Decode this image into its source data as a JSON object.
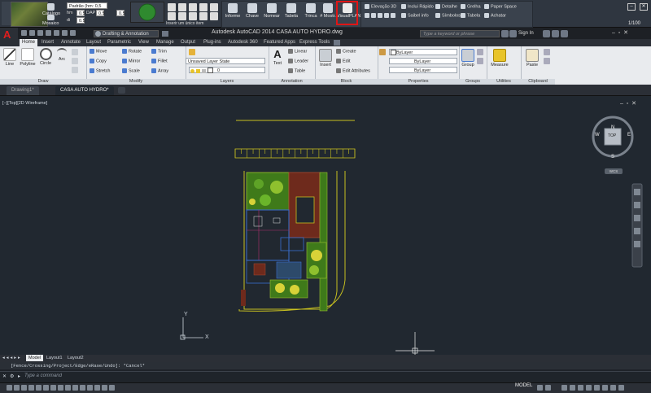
{
  "plugin_toolbar": {
    "left_buttons": [
      "Catálogo",
      "Mosaico"
    ],
    "pattern_value": "Padrão (hm: 0,5 di:",
    "hm_label": "hm",
    "hm_value": "0.5",
    "dap_label": "DAP",
    "dap_value": "0.5",
    "di_label": "di",
    "di_value": "0.5",
    "x_value": "0.5",
    "status_hint": "Inserir um único item",
    "tools": [
      "Informe",
      "Chave",
      "Nomear",
      "Tabela",
      "Trinca",
      "# Mostr.",
      "VisualPLAN"
    ],
    "list_col1": [
      "Elevação 3D",
      "Inclui Rápido"
    ],
    "list_col1b": [
      "",
      "Saibel info"
    ],
    "list_col2": [
      "Detalhe",
      "Símbolos"
    ],
    "list_col3": [
      "Grelha",
      "Tabela"
    ],
    "list_col4": [
      "Paper Space",
      "Achatar"
    ],
    "scale": "1/100"
  },
  "titlebar": {
    "title": "Autodesk AutoCAD 2014    CASA AUTO HYDRO.dwg",
    "workspace": "Drafting & Annotation",
    "search_placeholder": "Type a keyword or phrase",
    "sign_in": "Sign In"
  },
  "ribbon_tabs": [
    "Home",
    "Insert",
    "Annotate",
    "Layout",
    "Parametric",
    "View",
    "Manage",
    "Output",
    "Plug-ins",
    "Autodesk 360",
    "Featured Apps",
    "Express Tools"
  ],
  "ribbon": {
    "draw": {
      "title": "Draw",
      "buttons": [
        "Line",
        "Polyline",
        "Circle",
        "Arc"
      ]
    },
    "modify": {
      "title": "Modify",
      "rows": [
        [
          "Move",
          "Rotate",
          "Trim"
        ],
        [
          "Copy",
          "Mirror",
          "Fillet"
        ],
        [
          "Stretch",
          "Scale",
          "Array"
        ]
      ]
    },
    "layers": {
      "title": "Layers",
      "state": "Unsaved Layer State",
      "current": "0"
    },
    "annotation": {
      "title": "Annotation",
      "text": "Text",
      "rows": [
        "Linear",
        "Leader",
        "Table"
      ]
    },
    "block": {
      "title": "Block",
      "insert": "Insert",
      "rows": [
        "Create",
        "Edit",
        "Edit Attributes"
      ]
    },
    "properties": {
      "title": "Properties",
      "color": "ByLayer",
      "linetype": "ByLayer",
      "lineweight": "ByLayer"
    },
    "groups": {
      "title": "Groups",
      "label": "Group"
    },
    "utilities": {
      "title": "Utilities",
      "label": "Measure"
    },
    "clipboard": {
      "title": "Clipboard",
      "label": "Paste"
    }
  },
  "doc_tabs": [
    "Drawing1*",
    "CASA AUTO HYDRO*"
  ],
  "viewport": {
    "label": "[−][Top][2D Wireframe]",
    "compass": {
      "n": "N",
      "s": "S",
      "e": "E",
      "w": "W",
      "top": "TOP"
    },
    "wcs": "WCS"
  },
  "layout_tabs": [
    "Model",
    "Layout1",
    "Layout2"
  ],
  "command": {
    "history": "[Fence/Crossing/Project/Edge/eRase/Undo]: *Cancel*",
    "prompt": "Type a command"
  },
  "statusbar": {
    "model": "MODEL"
  }
}
